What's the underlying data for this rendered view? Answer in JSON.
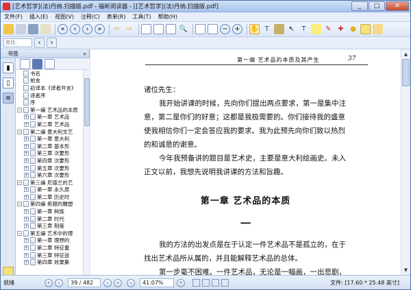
{
  "window": {
    "title": "[艺术哲学](法)丹纳.扫描版.pdf - 福昕阅读器 - [[艺术哲学](法)丹纳.扫描版.pdf]",
    "minimize": "_",
    "maximize": "□",
    "close": "✕"
  },
  "menu": [
    "文件(F)",
    "插入(E)",
    "视图(V)",
    "注释(C)",
    "表单(R)",
    "工具(T)",
    "帮助(H)"
  ],
  "search": {
    "placeholder": "查找:"
  },
  "sidebar": {
    "title": "书签",
    "collapse": "«",
    "items": [
      {
        "label": "书名",
        "level": 0,
        "expand": ""
      },
      {
        "label": "前言",
        "level": 0,
        "expand": ""
      },
      {
        "label": "初译本《译者弁言》",
        "level": 0,
        "expand": ""
      },
      {
        "label": "译者序",
        "level": 0,
        "expand": ""
      },
      {
        "label": "序",
        "level": 0,
        "expand": ""
      },
      {
        "label": "第一编 艺术品的本质",
        "level": 0,
        "expand": "−"
      },
      {
        "label": "第一章 艺术品",
        "level": 1,
        "expand": "+"
      },
      {
        "label": "第二章 艺术品",
        "level": 1,
        "expand": "+"
      },
      {
        "label": "第二编 意大利文艺",
        "level": 0,
        "expand": "−"
      },
      {
        "label": "第一章 意大利",
        "level": 1,
        "expand": "+"
      },
      {
        "label": "第二章 基本形",
        "level": 1,
        "expand": "+"
      },
      {
        "label": "第三章 次要形",
        "level": 1,
        "expand": "+"
      },
      {
        "label": "第四章 次要形",
        "level": 1,
        "expand": "+"
      },
      {
        "label": "第五章 次要形",
        "level": 1,
        "expand": "+"
      },
      {
        "label": "第六章 次要形",
        "level": 1,
        "expand": "+"
      },
      {
        "label": "第三编 尼德兰的艺",
        "level": 0,
        "expand": "−"
      },
      {
        "label": "第一章 永久原",
        "level": 1,
        "expand": "+"
      },
      {
        "label": "第二章 历史时",
        "level": 1,
        "expand": "+"
      },
      {
        "label": "第四编 希腊的雕塑",
        "level": 0,
        "expand": "−"
      },
      {
        "label": "第一章 种族",
        "level": 1,
        "expand": "+"
      },
      {
        "label": "第二章 时代",
        "level": 1,
        "expand": "+"
      },
      {
        "label": "第三章 制度",
        "level": 1,
        "expand": "+"
      },
      {
        "label": "第五编 艺术中的理",
        "level": 0,
        "expand": "−"
      },
      {
        "label": "第一章 理想的",
        "level": 1,
        "expand": "+"
      },
      {
        "label": "第二章 特征重",
        "level": 1,
        "expand": "+"
      },
      {
        "label": "第三章 特征益",
        "level": 1,
        "expand": "+"
      },
      {
        "label": "第四章 效果集",
        "level": 1,
        "expand": "+"
      }
    ]
  },
  "document": {
    "running_head": "第一编 艺术品的本质及其产生",
    "page_number": "37",
    "lines": [
      "诸位先生：",
      "我开始讲课的时候，先向你们提出两点要求，第一是集中注",
      "意，第二是你们的好意；这都是我极需要的。你们接待我的盛意",
      "使我相信你们一定会答应我的要求。我为此预先向你们致以热烈",
      "的和诚恳的谢意。",
      "今年我预备讲的题目是艺术史，主要是意大利绘画史。未入",
      "正文以前，我想先说明我讲课的方法和旨趣。"
    ],
    "chapter_title": "第一章 艺术品的本质",
    "section_number": "一",
    "lines2": [
      "我的方法的出发点是在于认定一件艺术品不是孤立的，在于",
      "找出艺术品所从属的，并且能解释艺术品的总体。",
      "第一步毫不困难。一件艺术品，无论是一幅画，一出悲剧，"
    ]
  },
  "status": {
    "ready": "就绪",
    "page_value": "39 / 482",
    "zoom_value": "41.07%",
    "doc_size": "文件: [17.60 * 25.48 英寸]"
  }
}
